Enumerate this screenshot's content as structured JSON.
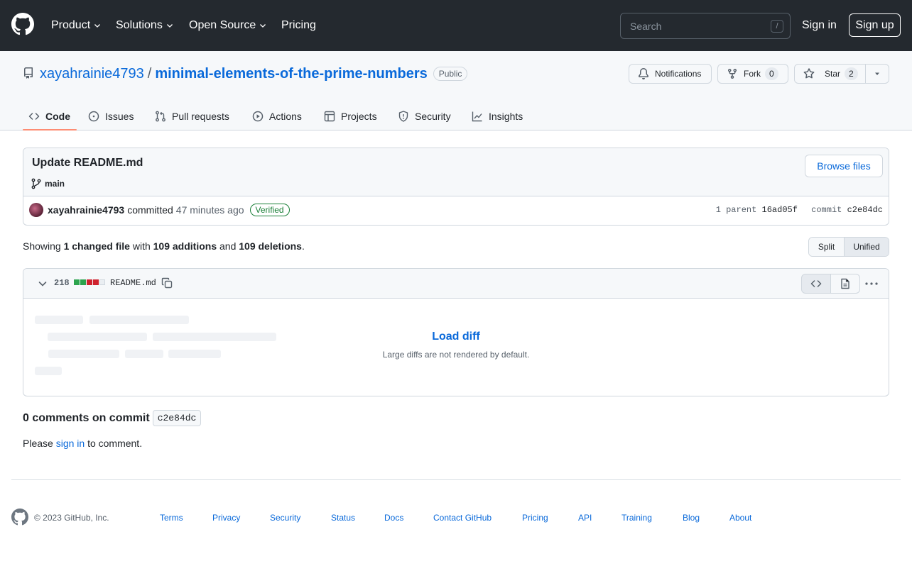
{
  "header": {
    "nav": [
      {
        "label": "Product",
        "has_menu": true
      },
      {
        "label": "Solutions",
        "has_menu": true
      },
      {
        "label": "Open Source",
        "has_menu": true
      },
      {
        "label": "Pricing",
        "has_menu": false
      }
    ],
    "search_placeholder": "Search",
    "search_shortcut": "/",
    "sign_in": "Sign in",
    "sign_up": "Sign up"
  },
  "repo": {
    "owner": "xayahrainie4793",
    "separator": "/",
    "name": "minimal-elements-of-the-prime-numbers",
    "visibility": "Public",
    "notifications_label": "Notifications",
    "fork_label": "Fork",
    "fork_count": "0",
    "star_label": "Star",
    "star_count": "2"
  },
  "tabs": [
    {
      "label": "Code",
      "icon": "code-icon",
      "active": true
    },
    {
      "label": "Issues",
      "icon": "issue-icon",
      "active": false
    },
    {
      "label": "Pull requests",
      "icon": "pull-request-icon",
      "active": false
    },
    {
      "label": "Actions",
      "icon": "play-icon",
      "active": false
    },
    {
      "label": "Projects",
      "icon": "table-icon",
      "active": false
    },
    {
      "label": "Security",
      "icon": "shield-icon",
      "active": false
    },
    {
      "label": "Insights",
      "icon": "graph-icon",
      "active": false
    }
  ],
  "commit": {
    "title": "Update README.md",
    "branch": "main",
    "browse_files": "Browse files",
    "author": "xayahrainie4793",
    "action": "committed",
    "time": "47 minutes ago",
    "verified": "Verified",
    "parent_count": "1",
    "parent_word": "parent",
    "parent_sha": "16ad05f",
    "commit_word": "commit",
    "sha": "c2e84dc"
  },
  "stats": {
    "showing": "Showing",
    "changed_files": "1 changed file",
    "with": "with",
    "additions": "109 additions",
    "and": "and",
    "deletions": "109 deletions",
    "period": ".",
    "split_label": "Split",
    "unified_label": "Unified"
  },
  "diff": {
    "count": "218",
    "filename": "README.md",
    "diffstat": [
      "add",
      "add",
      "del",
      "del",
      "neutral"
    ],
    "load_diff": "Load diff",
    "note": "Large diffs are not rendered by default."
  },
  "comments": {
    "title": "0 comments on commit",
    "sha": "c2e84dc",
    "please": "Please",
    "sign_in": "sign in",
    "to_comment": "to comment."
  },
  "footer": {
    "copyright": "© 2023 GitHub, Inc.",
    "links": [
      "Terms",
      "Privacy",
      "Security",
      "Status",
      "Docs",
      "Contact GitHub",
      "Pricing",
      "API",
      "Training",
      "Blog",
      "About"
    ]
  },
  "colors": {
    "header_bg": "#24292f",
    "link": "#0969da",
    "addition": "#2da44e",
    "deletion": "#cf222e",
    "neutral": "#d0d7de",
    "active_tab_underline": "#fd8c73",
    "verified": "#1a7f37"
  }
}
